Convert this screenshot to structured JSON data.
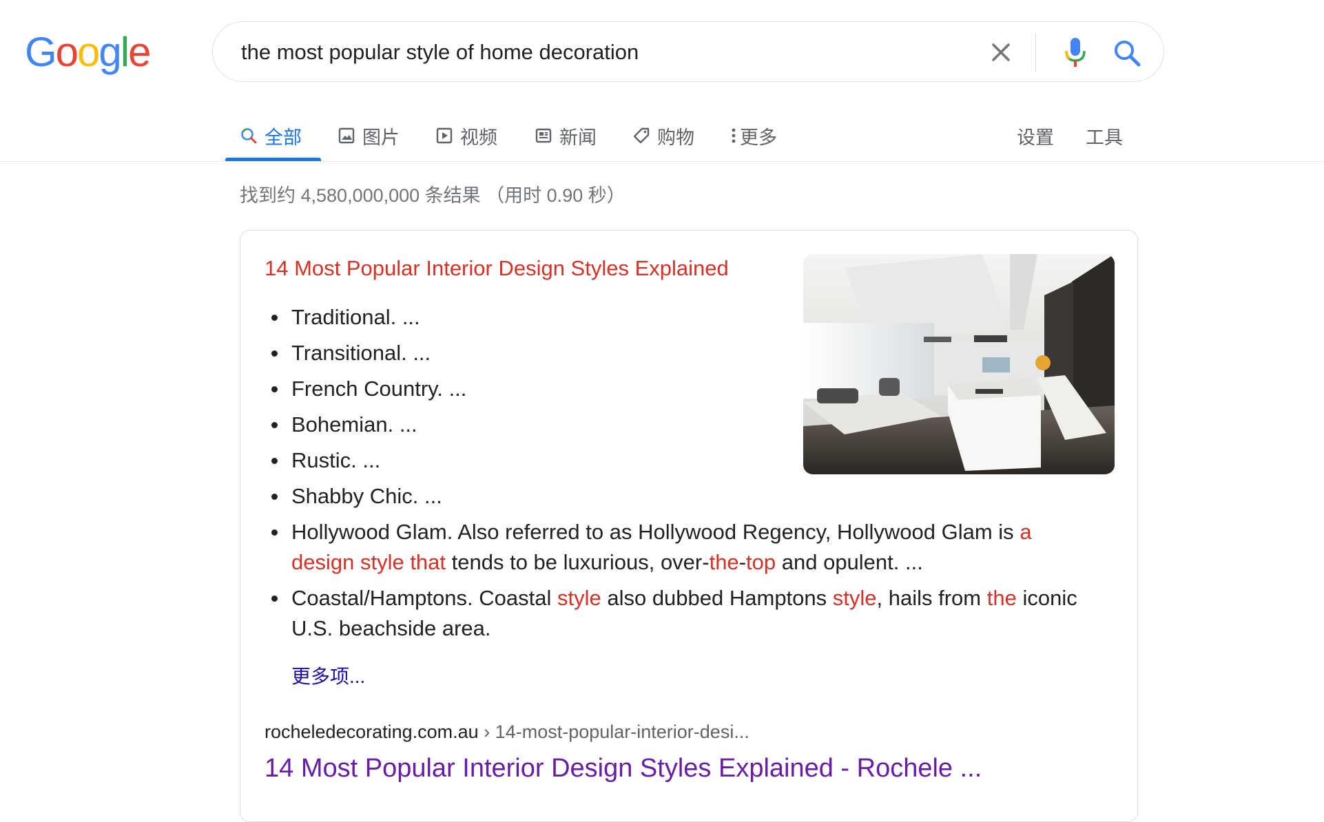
{
  "logo_text": "Google",
  "search": {
    "query": "the most popular style of home decoration"
  },
  "icons": {
    "clear": "close-icon",
    "voice": "mic-icon",
    "search": "search-icon"
  },
  "tabs": [
    {
      "label": "全部",
      "icon": "search-icon",
      "active": true
    },
    {
      "label": "图片",
      "icon": "image-icon"
    },
    {
      "label": "视频",
      "icon": "play-icon"
    },
    {
      "label": "新闻",
      "icon": "newspaper-icon"
    },
    {
      "label": "购物",
      "icon": "tag-icon"
    },
    {
      "label": "更多",
      "icon": "more-vert-icon"
    }
  ],
  "tabs_right": {
    "settings": "设置",
    "tools": "工具"
  },
  "result_stats": "找到约 4,580,000,000 条结果 （用时 0.90 秒）",
  "featured_snippet": {
    "heading": "14 Most Popular Interior Design Styles Explained",
    "items": [
      [
        {
          "t": "Traditional. ..."
        }
      ],
      [
        {
          "t": "Transitional. ..."
        }
      ],
      [
        {
          "t": "French Country. ..."
        }
      ],
      [
        {
          "t": "Bohemian. ..."
        }
      ],
      [
        {
          "t": "Rustic. ..."
        }
      ],
      [
        {
          "t": "Shabby Chic. ..."
        }
      ],
      [
        {
          "t": "Hollywood Glam. Also referred to as Hollywood Regency, Hollywood Glam is "
        },
        {
          "t": "a design style that",
          "hl": true
        },
        {
          "t": " tends to be luxurious, over-"
        },
        {
          "t": "the",
          "hl": true
        },
        {
          "t": "-"
        },
        {
          "t": "top",
          "hl": true
        },
        {
          "t": " and opulent. ..."
        }
      ],
      [
        {
          "t": "Coastal/Hamptons. Coastal "
        },
        {
          "t": "style",
          "hl": true
        },
        {
          "t": " also dubbed Hamptons "
        },
        {
          "t": "style",
          "hl": true
        },
        {
          "t": ", hails from "
        },
        {
          "t": "the",
          "hl": true
        },
        {
          "t": " iconic U.S. beachside area."
        }
      ]
    ],
    "more_link": "更多项...",
    "cite_domain": "rocheledecorating.com.au",
    "cite_path": " › 14-most-popular-interior-desi...",
    "result_title": "14 Most Popular Interior Design Styles Explained - Rochele ..."
  },
  "colors": {
    "accent": "#1a73e8",
    "highlight": "#d93025",
    "visited_link": "#681da8",
    "link": "#1a0dab"
  }
}
